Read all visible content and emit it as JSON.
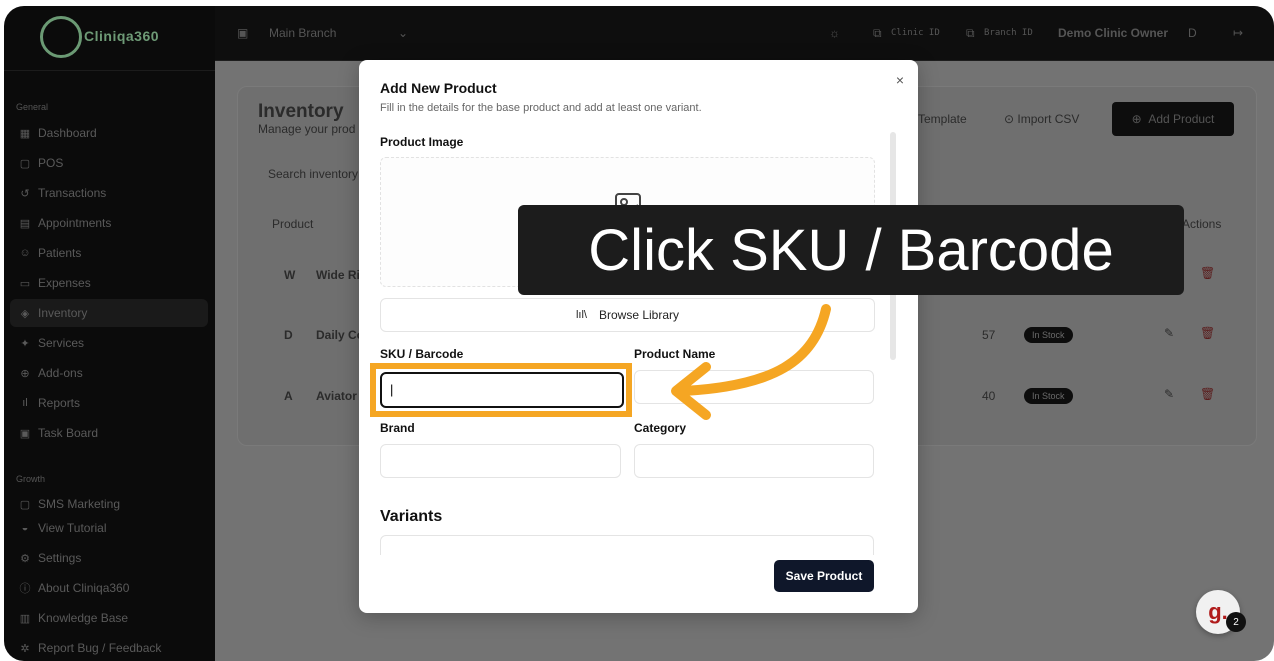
{
  "sidebar": {
    "brand": "Cliniqa360",
    "section_general": "General",
    "section_growth": "Growth",
    "items": [
      {
        "label": "Dashboard",
        "icon": "dashboard-icon"
      },
      {
        "label": "POS",
        "icon": "pos-icon"
      },
      {
        "label": "Transactions",
        "icon": "transactions-icon"
      },
      {
        "label": "Appointments",
        "icon": "calendar-icon"
      },
      {
        "label": "Patients",
        "icon": "users-icon"
      },
      {
        "label": "Expenses",
        "icon": "expenses-icon"
      },
      {
        "label": "Inventory",
        "icon": "inventory-icon"
      },
      {
        "label": "Services",
        "icon": "services-icon"
      },
      {
        "label": "Add-ons",
        "icon": "addons-icon"
      },
      {
        "label": "Reports",
        "icon": "reports-icon"
      },
      {
        "label": "Task Board",
        "icon": "taskboard-icon"
      }
    ],
    "growth_items": [
      {
        "label": "SMS Marketing"
      }
    ],
    "footer_items": [
      {
        "label": "View Tutorial"
      },
      {
        "label": "Settings"
      },
      {
        "label": "About Cliniqa360"
      },
      {
        "label": "Knowledge Base"
      },
      {
        "label": "Report Bug / Feedback"
      }
    ]
  },
  "topbar": {
    "branch": "Main Branch",
    "clinic_id": "Clinic ID",
    "branch_id": "Branch ID",
    "user": "Demo Clinic Owner",
    "avatar": "D"
  },
  "page": {
    "title": "Inventory",
    "subtitle": "Manage your prod",
    "search_placeholder": "Search inventory",
    "col_product": "Product",
    "col_actions": "Actions",
    "template_btn": "Template",
    "import_btn": "Import CSV",
    "add_btn": "Add Product",
    "rows": [
      {
        "initial": "W",
        "name": "Wide Ri",
        "qty": "",
        "status": ""
      },
      {
        "initial": "D",
        "name": "Daily Co",
        "qty": "57",
        "status": "In Stock"
      },
      {
        "initial": "A",
        "name": "Aviator",
        "qty": "40",
        "status": "In Stock"
      }
    ]
  },
  "modal": {
    "title": "Add New Product",
    "subtitle": "Fill in the details for the base product and add at least one variant.",
    "close": "×",
    "product_image_label": "Product Image",
    "browse_library": "Browse Library",
    "sku_label": "SKU / Barcode",
    "sku_value": "|",
    "product_name_label": "Product Name",
    "brand_label": "Brand",
    "category_label": "Category",
    "variants_label": "Variants",
    "save_button": "Save Product"
  },
  "annotation": {
    "tooltip": "Click SKU / Barcode",
    "accent_color": "#f5a623"
  },
  "guide": {
    "letter": "g.",
    "badge": "2"
  }
}
